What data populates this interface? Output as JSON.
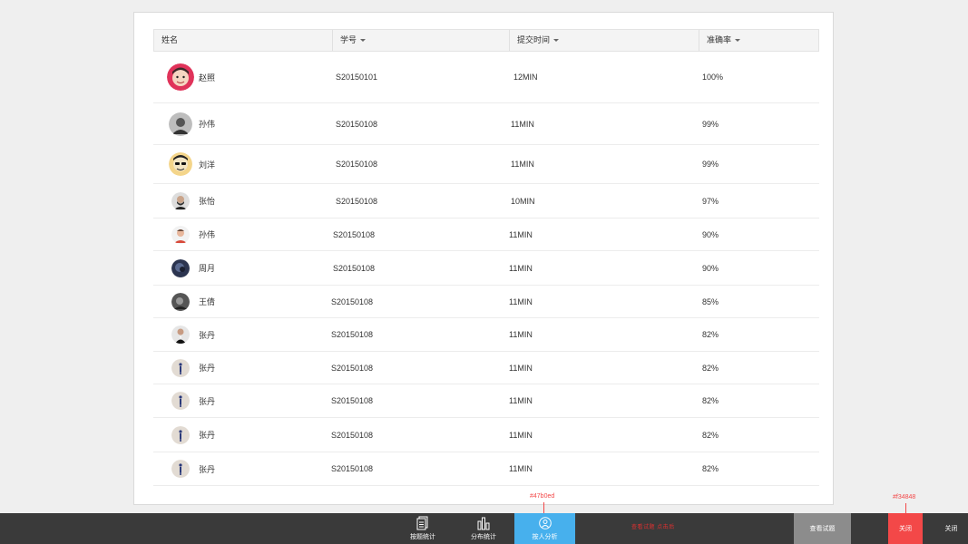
{
  "table": {
    "columns": [
      {
        "label": "姓名",
        "sortable": false
      },
      {
        "label": "学号",
        "sortable": true
      },
      {
        "label": "提交时间",
        "sortable": true
      },
      {
        "label": "准确率",
        "sortable": true
      }
    ],
    "rows": [
      {
        "name": "赵照",
        "id": "S20150101",
        "time": "12MIN",
        "accuracy": "100%",
        "avatar": "cartoon-red"
      },
      {
        "name": "孙伟",
        "id": "S20150108",
        "time": "11MIN",
        "accuracy": "99%",
        "avatar": "gray-portrait"
      },
      {
        "name": "刘洋",
        "id": "S20150108",
        "time": "11MIN",
        "accuracy": "99%",
        "avatar": "sunglasses-yellow"
      },
      {
        "name": "张怡",
        "id": "S20150108",
        "time": "10MIN",
        "accuracy": "97%",
        "avatar": "bearded-man"
      },
      {
        "name": "孙伟",
        "id": "S20150108",
        "time": "11MIN",
        "accuracy": "90%",
        "avatar": "light-portrait"
      },
      {
        "name": "周月",
        "id": "S20150108",
        "time": "11MIN",
        "accuracy": "90%",
        "avatar": "dark-blue"
      },
      {
        "name": "王倩",
        "id": "S20150108",
        "time": "11MIN",
        "accuracy": "85%",
        "avatar": "dark-portrait"
      },
      {
        "name": "张丹",
        "id": "S20150108",
        "time": "11MIN",
        "accuracy": "82%",
        "avatar": "suit-man"
      },
      {
        "name": "张丹",
        "id": "S20150108",
        "time": "11MIN",
        "accuracy": "82%",
        "avatar": "default-figure"
      },
      {
        "name": "张丹",
        "id": "S20150108",
        "time": "11MIN",
        "accuracy": "82%",
        "avatar": "default-figure"
      },
      {
        "name": "张丹",
        "id": "S20150108",
        "time": "11MIN",
        "accuracy": "82%",
        "avatar": "default-figure"
      },
      {
        "name": "张丹",
        "id": "S20150108",
        "time": "11MIN",
        "accuracy": "82%",
        "avatar": "default-figure"
      }
    ]
  },
  "toolbar": {
    "by_question": {
      "label": "按题统计",
      "icon": "document-icon"
    },
    "distribution": {
      "label": "分布统计",
      "icon": "bar-chart-icon"
    },
    "by_person": {
      "label": "按人分析",
      "icon": "person-icon",
      "active": true
    },
    "note": "查看试题",
    "view_questions": "查看试题",
    "close_active": "关闭",
    "close": "关闭"
  },
  "annotations": {
    "active_color": "#47b0ed",
    "close_color": "#f34848",
    "red_note": "查看试题 点击后"
  },
  "colors": {
    "toolbar_bg": "#3a3a3a",
    "active_blue": "#47b0ed",
    "close_red": "#f34848",
    "view_btn_gray": "#8c8c8c"
  }
}
